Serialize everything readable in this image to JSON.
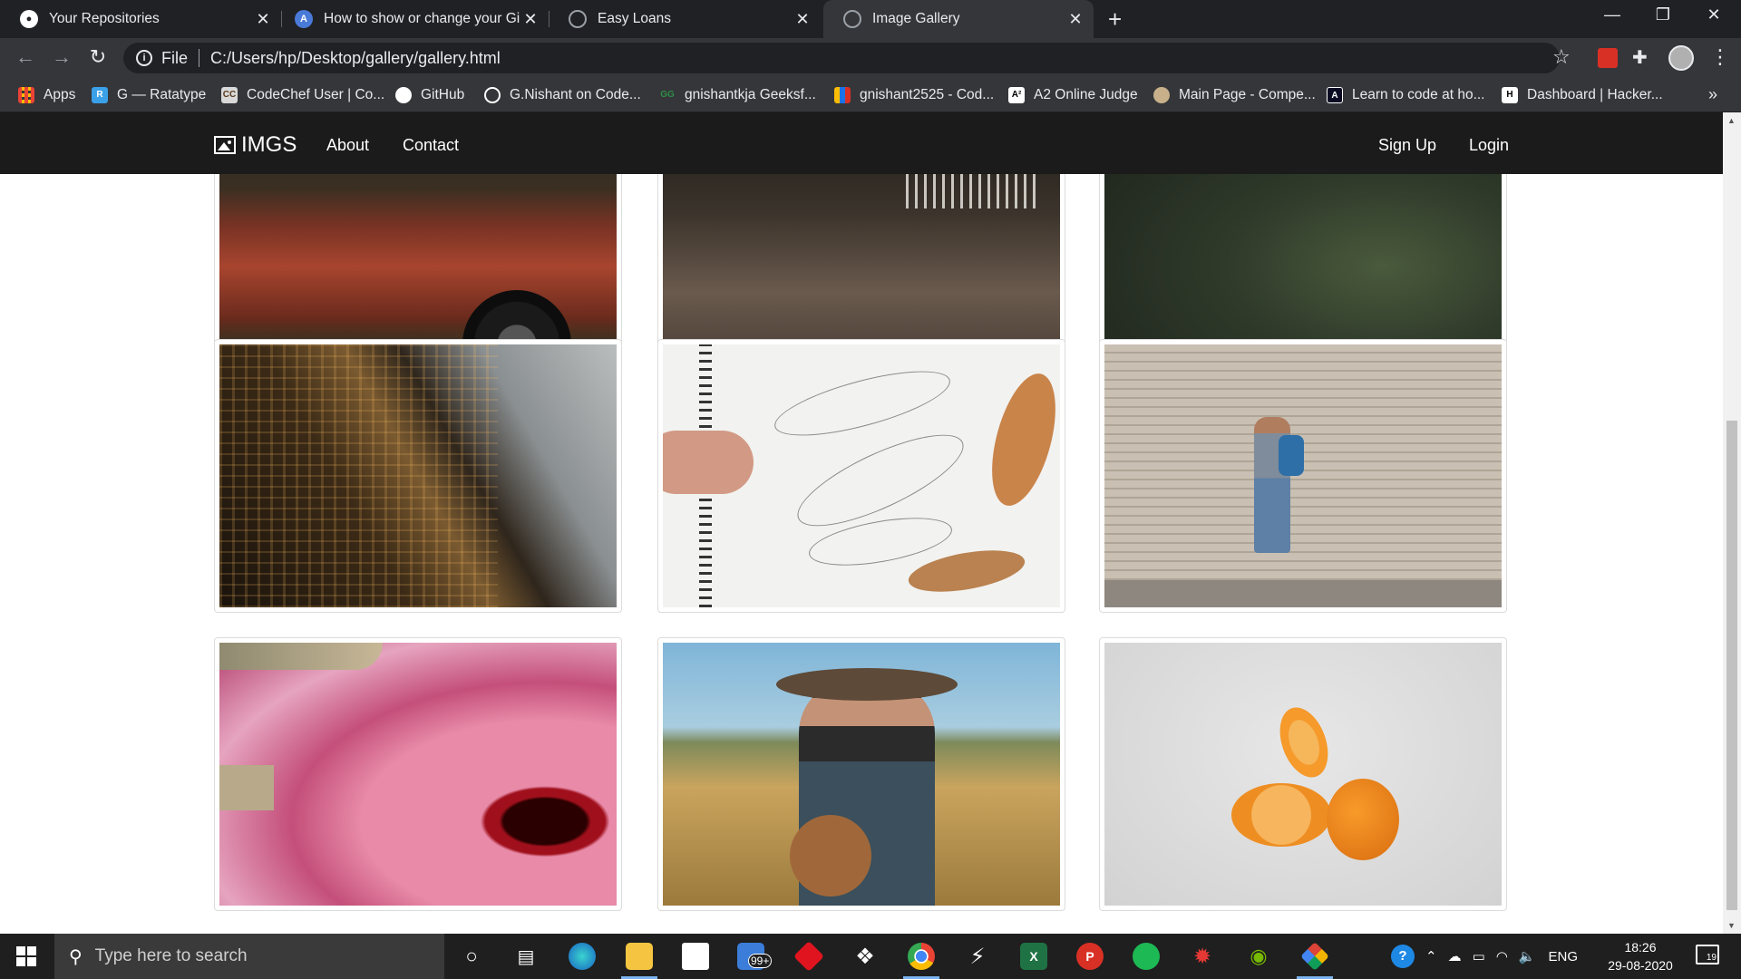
{
  "browser": {
    "tabs": [
      {
        "title": "Your Repositories",
        "icon": "github-icon"
      },
      {
        "title": "How to show or change your Git",
        "icon": "a-letter-icon"
      },
      {
        "title": "Easy Loans",
        "icon": "globe-icon"
      },
      {
        "title": "Image Gallery",
        "icon": "globe-icon",
        "active": true
      }
    ],
    "address": {
      "scheme_label": "File",
      "url": "C:/Users/hp/Desktop/gallery/gallery.html"
    },
    "bookmarks": [
      {
        "label": "Apps",
        "icon": "apps-grid-icon"
      },
      {
        "label": "G — Ratatype",
        "icon": "ratatype-icon"
      },
      {
        "label": "CodeChef User | Co...",
        "icon": "codechef-icon"
      },
      {
        "label": "GitHub",
        "icon": "github-icon"
      },
      {
        "label": "G.Nishant on Code...",
        "icon": "codeforces-icon"
      },
      {
        "label": "gnishantkja Geeksf...",
        "icon": "geeksforgeeks-icon"
      },
      {
        "label": "gnishant2525 - Cod...",
        "icon": "bars-icon"
      },
      {
        "label": "A2 Online Judge",
        "icon": "a2-icon"
      },
      {
        "label": "Main Page - Compe...",
        "icon": "wiki-icon"
      },
      {
        "label": "Learn to code at ho...",
        "icon": "freecodecamp-icon"
      },
      {
        "label": "Dashboard | Hacker...",
        "icon": "hackerrank-icon"
      }
    ]
  },
  "site": {
    "brand": "IMGS",
    "nav_links": [
      "About",
      "Contact"
    ],
    "auth_links": [
      "Sign Up",
      "Login"
    ],
    "gallery": [
      {
        "subject": "red car wheel"
      },
      {
        "subject": "person at phone booth"
      },
      {
        "subject": "rocky landscape"
      },
      {
        "subject": "skyscrapers at dusk"
      },
      {
        "subject": "leaf sketches"
      },
      {
        "subject": "man walking past shutter"
      },
      {
        "subject": "pink salt lake aerial"
      },
      {
        "subject": "man playing guitar"
      },
      {
        "subject": "orange slices"
      }
    ]
  },
  "taskbar": {
    "search_placeholder": "Type here to search",
    "mail_badge": "99+",
    "language": "ENG",
    "time": "18:26",
    "date": "29-08-2020",
    "notifications": "19"
  }
}
